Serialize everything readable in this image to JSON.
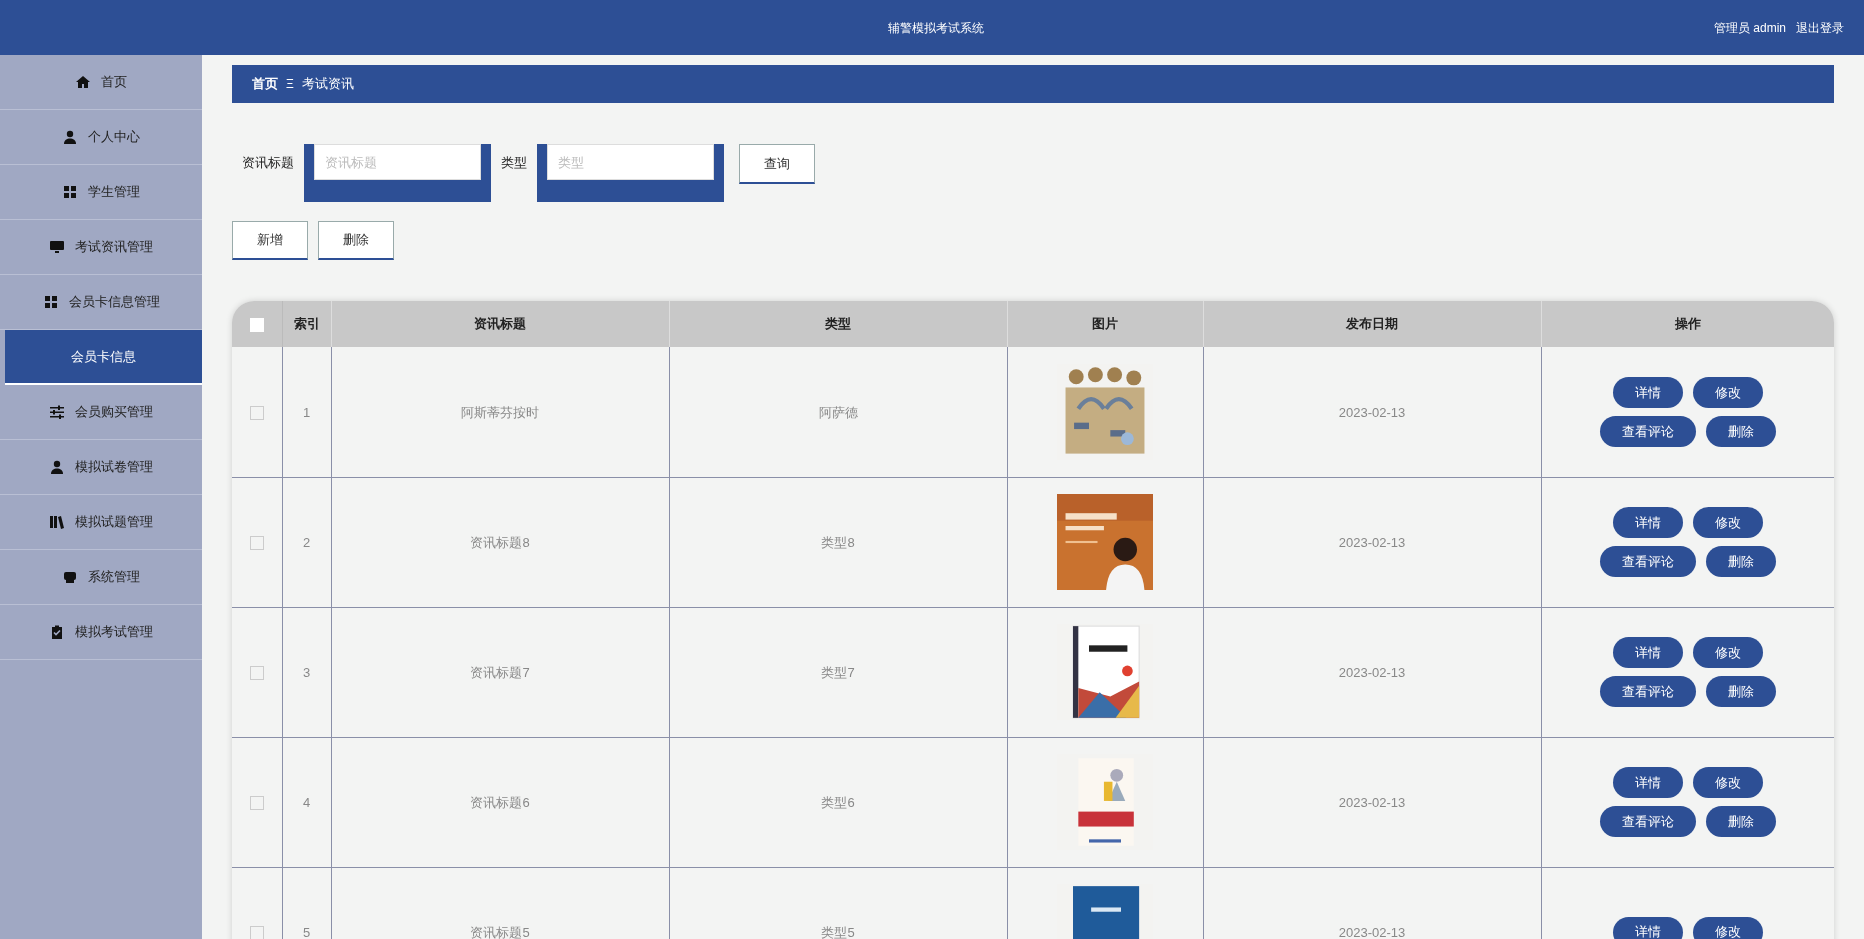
{
  "header": {
    "title": "辅警模拟考试系统",
    "user": "管理员 admin",
    "logout": "退出登录"
  },
  "sidebar": {
    "items": [
      {
        "label": "首页",
        "selected": false
      },
      {
        "label": "个人中心",
        "selected": false
      },
      {
        "label": "学生管理",
        "selected": false
      },
      {
        "label": "考试资讯管理",
        "selected": false
      },
      {
        "label": "会员卡信息管理",
        "selected": false,
        "expanded": true,
        "children": [
          {
            "label": "会员卡信息",
            "selected": true
          }
        ]
      },
      {
        "label": "会员购买管理",
        "selected": false
      },
      {
        "label": "模拟试卷管理",
        "selected": false
      },
      {
        "label": "模拟试题管理",
        "selected": false
      },
      {
        "label": "系统管理",
        "selected": false
      },
      {
        "label": "模拟考试管理",
        "selected": false
      }
    ]
  },
  "breadcrumb": {
    "home": "首页",
    "separator": "Ξ",
    "current": "考试资讯"
  },
  "search": {
    "fields": [
      {
        "label": "资讯标题",
        "placeholder": "资讯标题"
      },
      {
        "label": "类型",
        "placeholder": "类型"
      }
    ],
    "button": "查询"
  },
  "actions": [
    "新增",
    "删除"
  ],
  "table": {
    "select_all": {
      "checked": false
    },
    "columns": [
      "索引",
      "资讯标题",
      "类型",
      "图片",
      "发布日期",
      "操作"
    ],
    "rows": [
      {
        "checked": false,
        "index": "1",
        "title": "阿斯蒂芬按时",
        "type": "阿萨德",
        "image": {
          "kind": "picture"
        },
        "date": "2023-02-13",
        "buttons": [
          "详情",
          "修改",
          "查看评论",
          "删除"
        ]
      },
      {
        "checked": false,
        "index": "2",
        "title": "资讯标题8",
        "type": "类型8",
        "image": {
          "kind": "picture"
        },
        "date": "2023-02-13",
        "buttons": [
          "详情",
          "修改",
          "查看评论",
          "删除"
        ]
      },
      {
        "checked": false,
        "index": "3",
        "title": "资讯标题7",
        "type": "类型7",
        "image": {
          "kind": "picture"
        },
        "date": "2023-02-13",
        "buttons": [
          "详情",
          "修改",
          "查看评论",
          "删除"
        ]
      },
      {
        "checked": false,
        "index": "4",
        "title": "资讯标题6",
        "type": "类型6",
        "image": {
          "kind": "picture"
        },
        "date": "2023-02-13",
        "buttons": [
          "详情",
          "修改",
          "查看评论",
          "删除"
        ]
      },
      {
        "checked": false,
        "index": "5",
        "title": "资讯标题5",
        "type": "类型5",
        "image": {
          "kind": "picture"
        },
        "date": "2023-02-13",
        "buttons": [
          "详情",
          "修改"
        ]
      }
    ]
  }
}
